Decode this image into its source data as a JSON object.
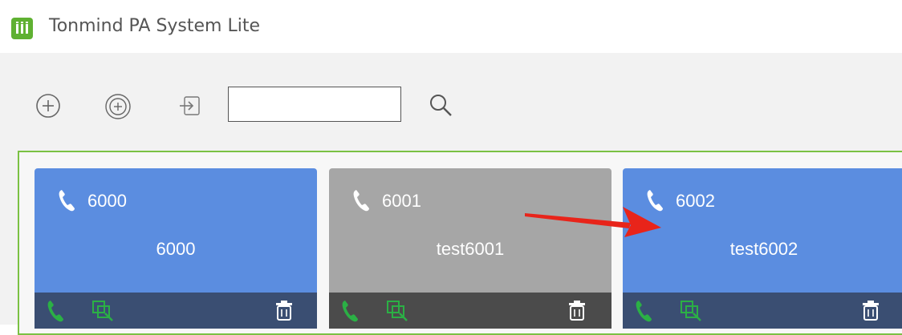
{
  "app": {
    "title": "Tonmind PA System Lite",
    "logo_text": "lil",
    "logo_color": "#5fb132"
  },
  "toolbar": {
    "add_icon": "circle-plus-icon",
    "add_group_icon": "double-circle-plus-icon",
    "import_icon": "import-icon",
    "search_icon": "search-icon",
    "search_value": "",
    "search_placeholder": ""
  },
  "colors": {
    "accent_green": "#7ac143",
    "card_blue": "#5b8de0",
    "card_gray": "#a6a6a6",
    "footer_blue": "#3a4e72",
    "footer_gray": "#4b4b4b",
    "action_green": "#2bb045",
    "arrow_red": "#e8241a"
  },
  "devices": [
    {
      "extension": "6000",
      "name": "6000",
      "state": "online",
      "color": "#5b8de0",
      "footer_color": "#3a4e72"
    },
    {
      "extension": "6001",
      "name": "test6001",
      "state": "offline",
      "color": "#a6a6a6",
      "footer_color": "#4b4b4b"
    },
    {
      "extension": "6002",
      "name": "test6002",
      "state": "online",
      "color": "#5b8de0",
      "footer_color": "#3a4e72"
    }
  ],
  "card_actions": {
    "call_icon": "phone-call-icon",
    "copy_icon": "copy-config-icon",
    "delete_icon": "trash-icon"
  },
  "annotation": {
    "arrow_icon": "red-arrow-icon"
  }
}
